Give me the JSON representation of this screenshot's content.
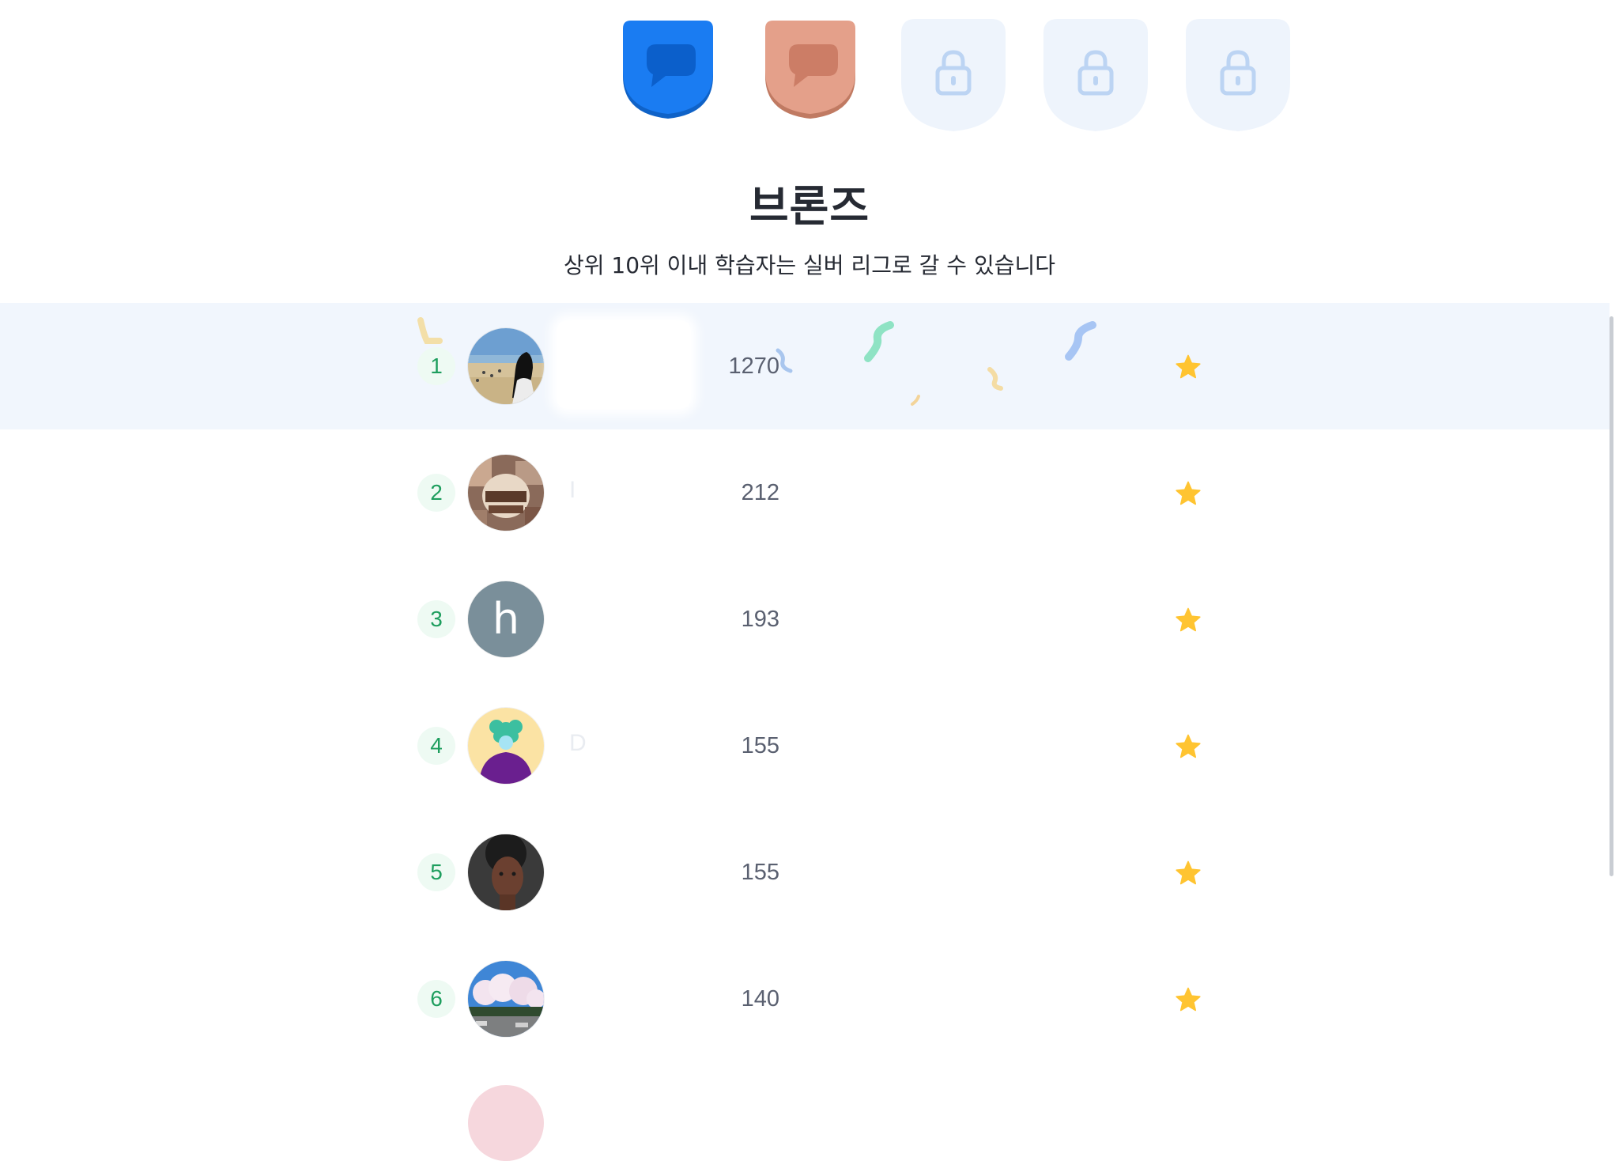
{
  "league": {
    "badges": [
      {
        "name": "bronze-league",
        "state": "unlocked",
        "color": "#1a7cf2"
      },
      {
        "name": "silver-league",
        "state": "unlocked",
        "color": "#e29a80"
      },
      {
        "name": "locked-league-1",
        "state": "locked"
      },
      {
        "name": "locked-league-2",
        "state": "locked"
      },
      {
        "name": "locked-league-3",
        "state": "locked"
      }
    ],
    "title": "브론즈",
    "subtitle": "상위 10위 이내 학습자는 실버 리그로 갈 수 있습니다"
  },
  "leaderboard": {
    "rows": [
      {
        "rank": "1",
        "name": "",
        "score": "1270",
        "avatar": "beach-photo",
        "highlight": true
      },
      {
        "rank": "2",
        "name": "I",
        "score": "212",
        "avatar": "pattern-photo"
      },
      {
        "rank": "3",
        "name": "",
        "score": "193",
        "avatar": "letter",
        "avatar_letter": "h"
      },
      {
        "rank": "4",
        "name": "D",
        "score": "155",
        "avatar": "illustration"
      },
      {
        "rank": "5",
        "name": "",
        "score": "155",
        "avatar": "portrait-photo"
      },
      {
        "rank": "6",
        "name": "",
        "score": "140",
        "avatar": "blossom-photo"
      }
    ],
    "score_icon": "star-icon"
  },
  "colors": {
    "highlight_row": "#f1f6fd",
    "rank_text": "#1e9e5e",
    "star": "#ffc431"
  }
}
